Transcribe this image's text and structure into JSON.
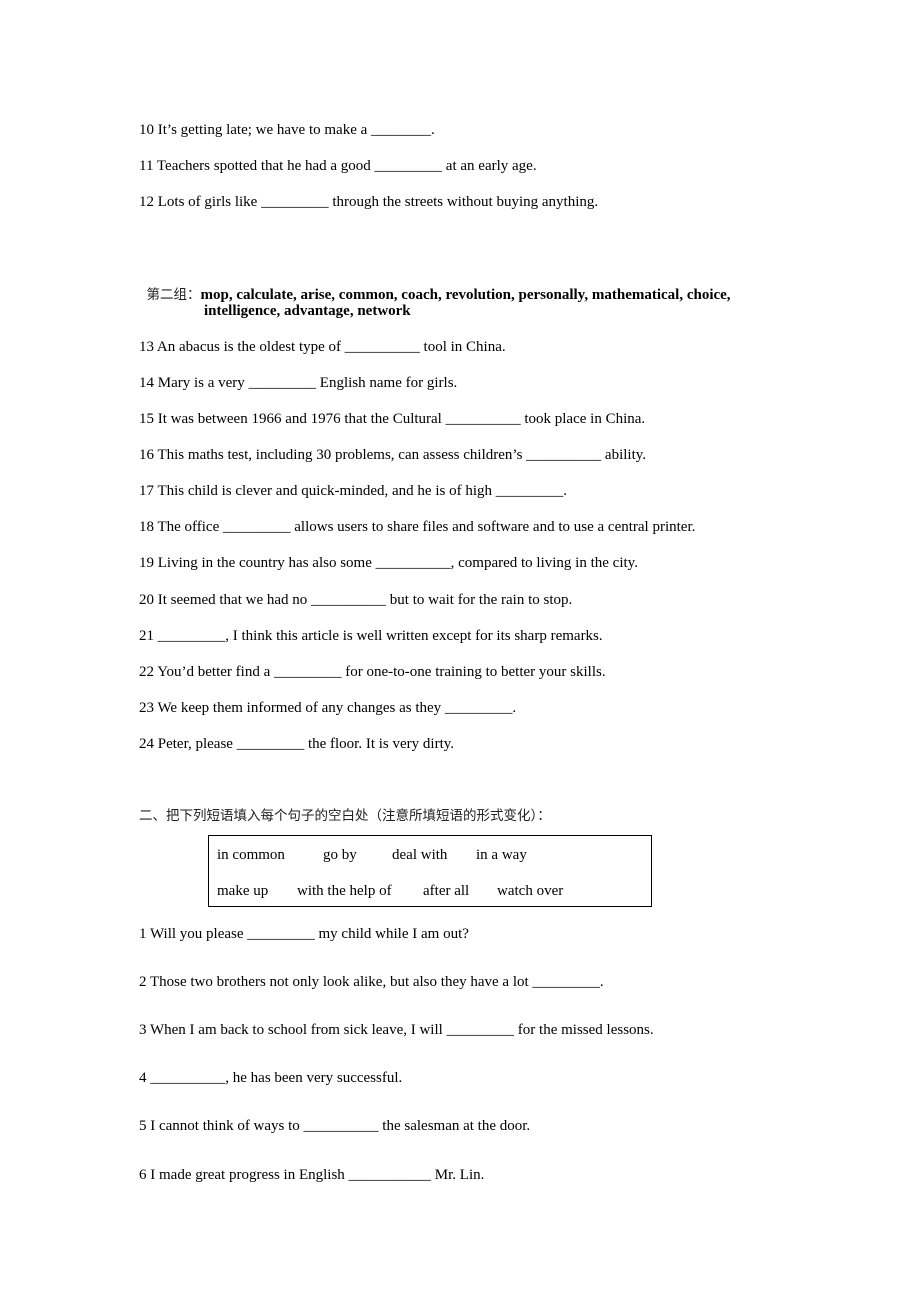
{
  "section1_tail": {
    "items": [
      "10 It’s getting late; we have to make a ________.",
      "11 Teachers spotted that he had a good _________ at an early age.",
      "12 Lots of girls like _________ through the streets without buying anything."
    ]
  },
  "group2": {
    "label": "第二组：",
    "words_line1": "mop, calculate, arise, common, coach, revolution, personally, mathematical, choice,",
    "words_line2": "intelligence, advantage, network",
    "items": [
      "13 An abacus is the oldest type of __________ tool in China.",
      "14 Mary is a very _________ English name for girls.",
      "15 It was between 1966 and 1976 that the Cultural __________ took place in China.",
      "16 This maths test, including 30 problems, can assess children’s __________ ability.",
      "17 This child is clever and quick-minded, and he is of high _________.",
      "18 The office _________ allows users to share files and software and to use a central printer.",
      "19 Living in the country has also some __________, compared to living in the city.",
      "20 It seemed that we had no __________ but to wait for the rain to stop.",
      "21 _________, I think this article is well written except for its sharp remarks.",
      "22 You’d better find a _________ for one-to-one training to better your skills.",
      "23 We keep them informed of any changes as they _________.",
      "24 Peter, please _________ the floor. It is very dirty."
    ]
  },
  "part2": {
    "heading": "二、把下列短语填入每个句子的空白处（注意所填短语的形式变化）：",
    "phrases_row1": [
      "in common",
      "go by",
      "deal with",
      "in a way"
    ],
    "phrases_row2": [
      "make up",
      "with the help of",
      "after all",
      "watch over"
    ],
    "items": [
      "1 Will you please _________ my child while I am out?",
      "2 Those two brothers not only look alike, but also they have a lot _________.",
      "3 When I am back to school from sick leave, I will _________ for the missed lessons.",
      "4 __________, he has been very successful.",
      "5 I cannot think of ways to __________ the salesman at the door.",
      "6 I made great progress in English ___________ Mr. Lin."
    ]
  }
}
